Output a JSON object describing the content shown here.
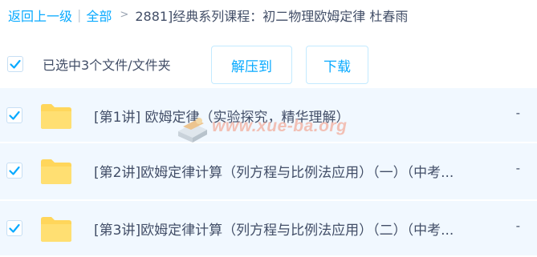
{
  "breadcrumb": {
    "back": "返回上一级",
    "separator": "|",
    "all": "全部",
    "arrow": ">",
    "current": "2881]经典系列课程：初二物理欧姆定律 杜春雨"
  },
  "toolbar": {
    "selected_text": "已选中3个文件/文件夹",
    "extract_label": "解压到",
    "download_label": "下载"
  },
  "files": [
    {
      "name": "[第1讲] 欧姆定律（实验探究，精华理解）",
      "size": "-",
      "checked": true,
      "icon": "folder-icon"
    },
    {
      "name": "[第2讲]欧姆定律计算（列方程与比例法应用）（一）（中考...",
      "size": "-",
      "checked": true,
      "icon": "folder-icon"
    },
    {
      "name": "[第3讲]欧姆定律计算（列方程与比例法应用）（二）（中考...",
      "size": "-",
      "checked": true,
      "icon": "folder-icon"
    }
  ],
  "watermark": {
    "text": "www.xue-ba.org"
  },
  "colors": {
    "accent": "#09aaff",
    "row_background": "#f1f8ff",
    "folder": "#ffd65b",
    "text": "#424e67"
  }
}
